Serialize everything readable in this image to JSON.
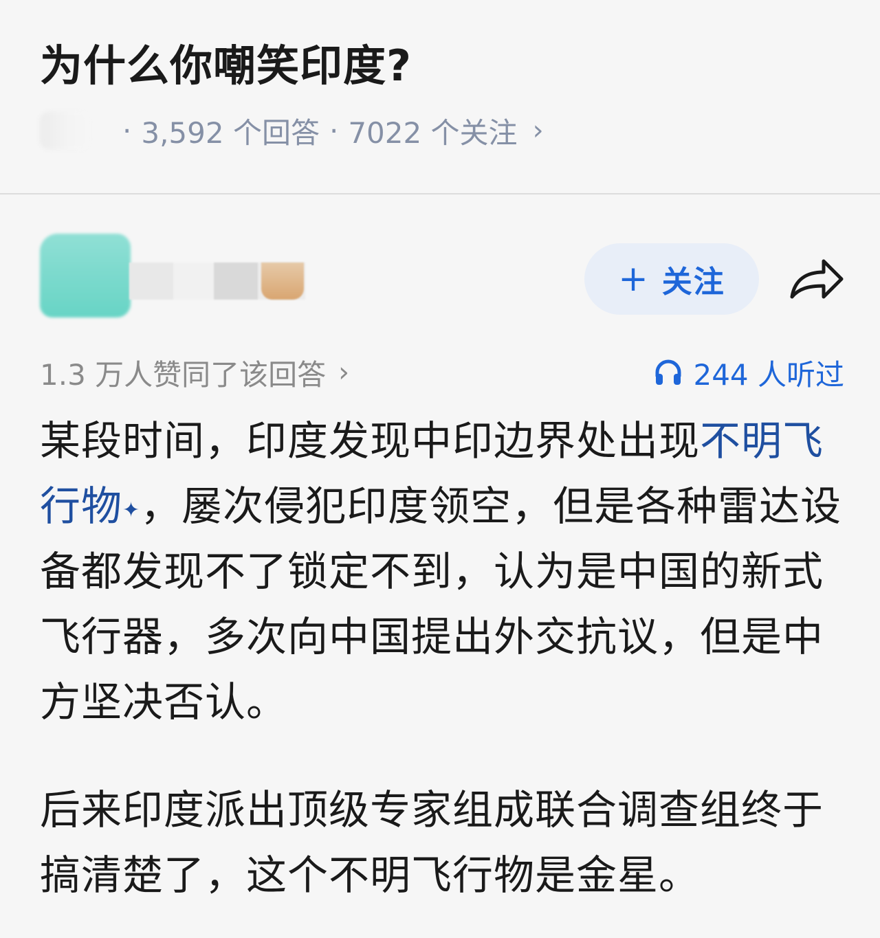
{
  "question": {
    "title": "为什么你嘲笑印度?",
    "answer_count": "3,592 个回答",
    "follower_count": "7022 个关注",
    "separator": "·"
  },
  "author": {
    "follow_label": "关注",
    "follow_prefix": "+"
  },
  "stats": {
    "agree_text": "1.3 万人赞同了该回答",
    "listen_text": "244 人听过"
  },
  "answer": {
    "p1_before_link": "某段时间，印度发现中印边界处出现",
    "p1_link": "不明飞行物",
    "p1_link_mark": "✦",
    "p1_after_link": "，屡次侵犯印度领空，但是各种雷达设备都发现不了锁定不到，认为是中国的新式飞行器，多次向中国提出外交抗议，但是中方坚决否认。",
    "p2": "后来印度派出顶级专家组成联合调查组终于搞清楚了，这个不明飞行物是金星。"
  },
  "colors": {
    "accent": "#1e66d9",
    "link": "#1f4fa0",
    "meta": "#8590a6"
  }
}
